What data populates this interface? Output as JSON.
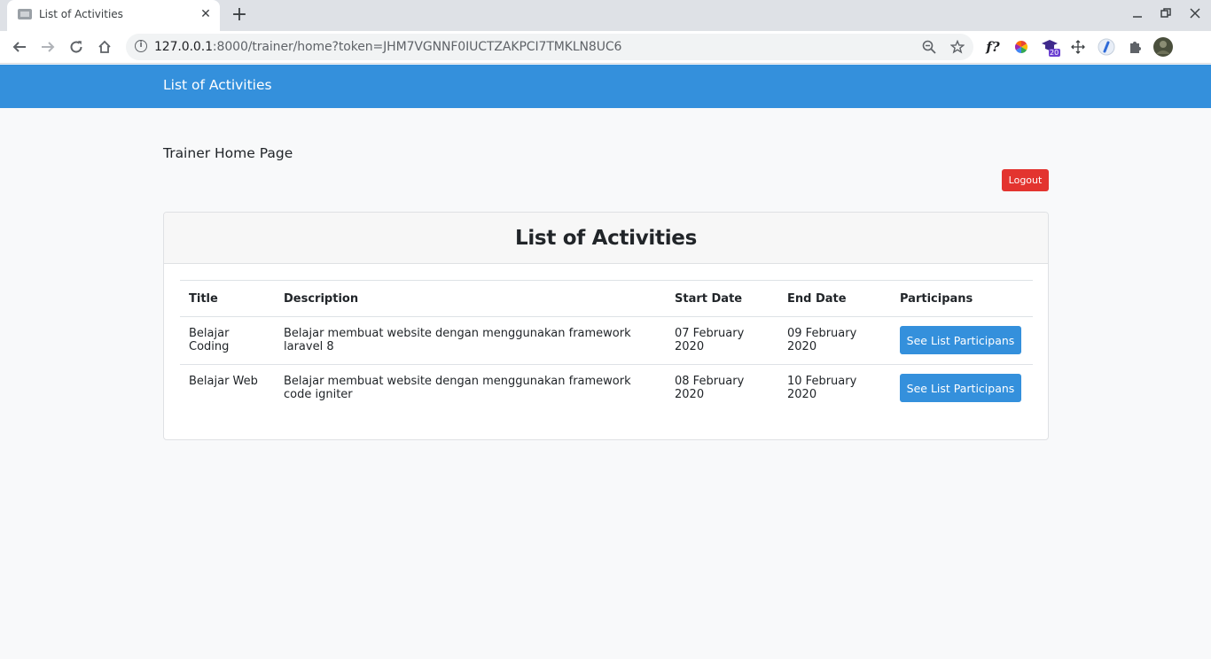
{
  "browser": {
    "tab_title": "List of Activities",
    "tab_close": "✕",
    "new_tab": "+",
    "url_host": "127.0.0.1",
    "url_rest": ":8000/trainer/home?token=JHM7VGNNF0IUCTZAKPCI7TMKLN8UC6",
    "extension_badge": "20",
    "formula_ext": "f?"
  },
  "navbar": {
    "brand": "List of Activities"
  },
  "page": {
    "heading": "Trainer Home Page",
    "logout_label": "Logout",
    "card_title": "List of Activities"
  },
  "table": {
    "headers": [
      "Title",
      "Description",
      "Start Date",
      "End Date",
      "Participans"
    ],
    "rows": [
      {
        "title": "Belajar Coding",
        "description": "Belajar membuat website dengan menggunakan framework laravel 8",
        "start": "07 February 2020",
        "end": "09 February 2020",
        "button": "See List Participans"
      },
      {
        "title": "Belajar Web",
        "description": "Belajar membuat website dengan menggunakan framework code igniter",
        "start": "08 February 2020",
        "end": "10 February 2020",
        "button": "See List Participans"
      }
    ]
  },
  "colors": {
    "primary": "#3490dc",
    "danger": "#e3342f",
    "background": "#f8f9fa"
  }
}
